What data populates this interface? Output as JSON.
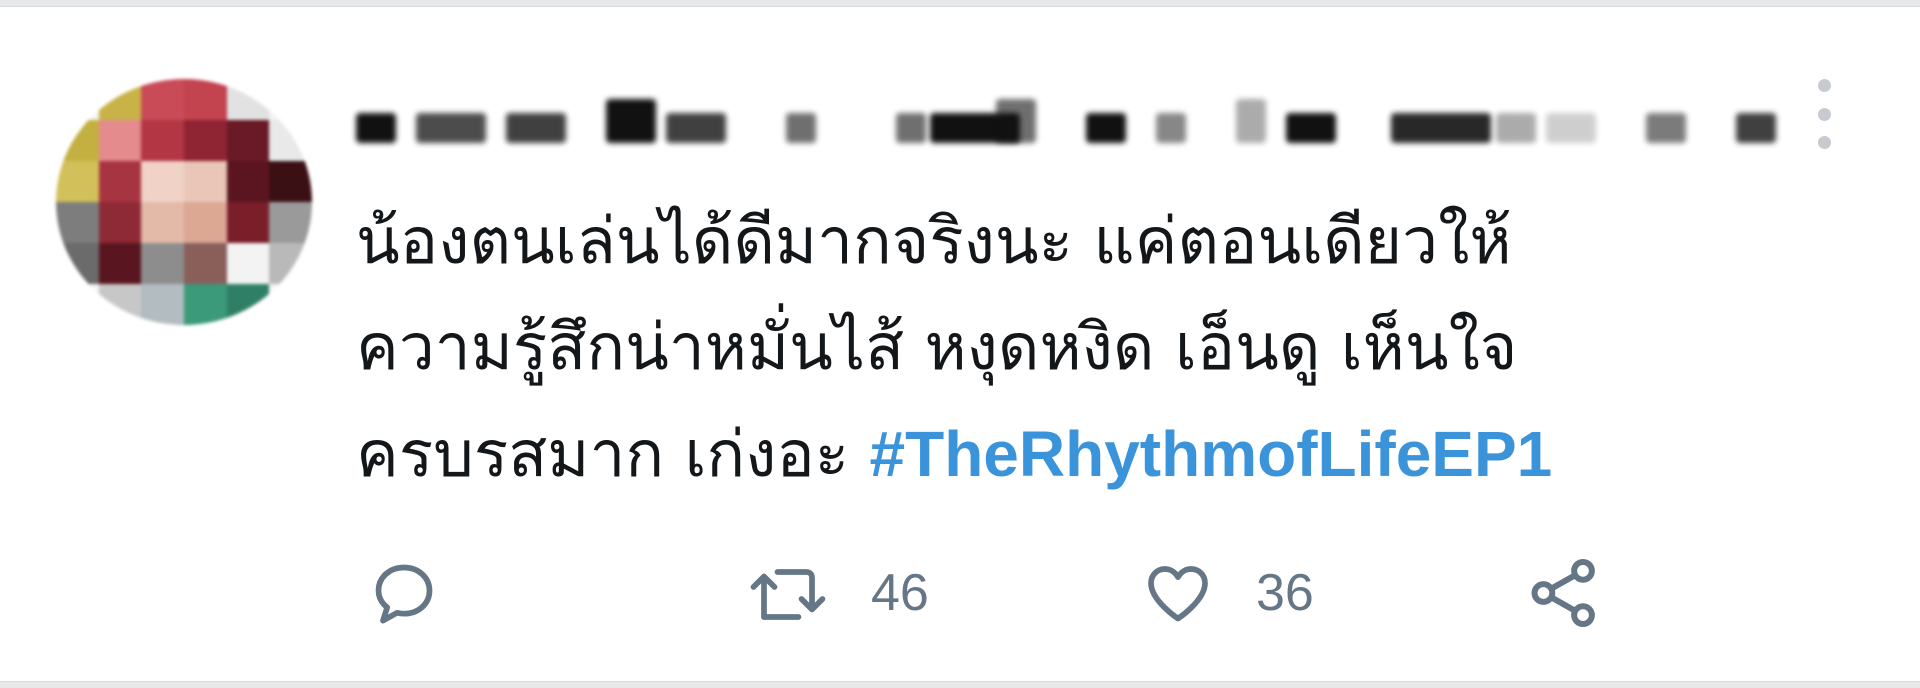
{
  "tweet": {
    "text": "น้องตนเล่นได้ดีมากจริงนะ แค่ตอนเดียวให้\nความรู้สึกน่าหมั่นไส้ หงุดหงิด เอ็นดู เห็นใจ\nครบรสมาก เก่งอะ ",
    "hashtag": "#TheRhythmofLifeEP1"
  },
  "actions": {
    "reply": {
      "icon": "reply-icon"
    },
    "retweet": {
      "icon": "retweet-icon",
      "count": "46"
    },
    "like": {
      "icon": "heart-icon",
      "count": "36"
    },
    "share": {
      "icon": "share-icon"
    }
  },
  "colors": {
    "text": "#14171a",
    "hashtag": "#3b94d9",
    "icon": "#657786",
    "more_dots": "#c7cbcf"
  }
}
